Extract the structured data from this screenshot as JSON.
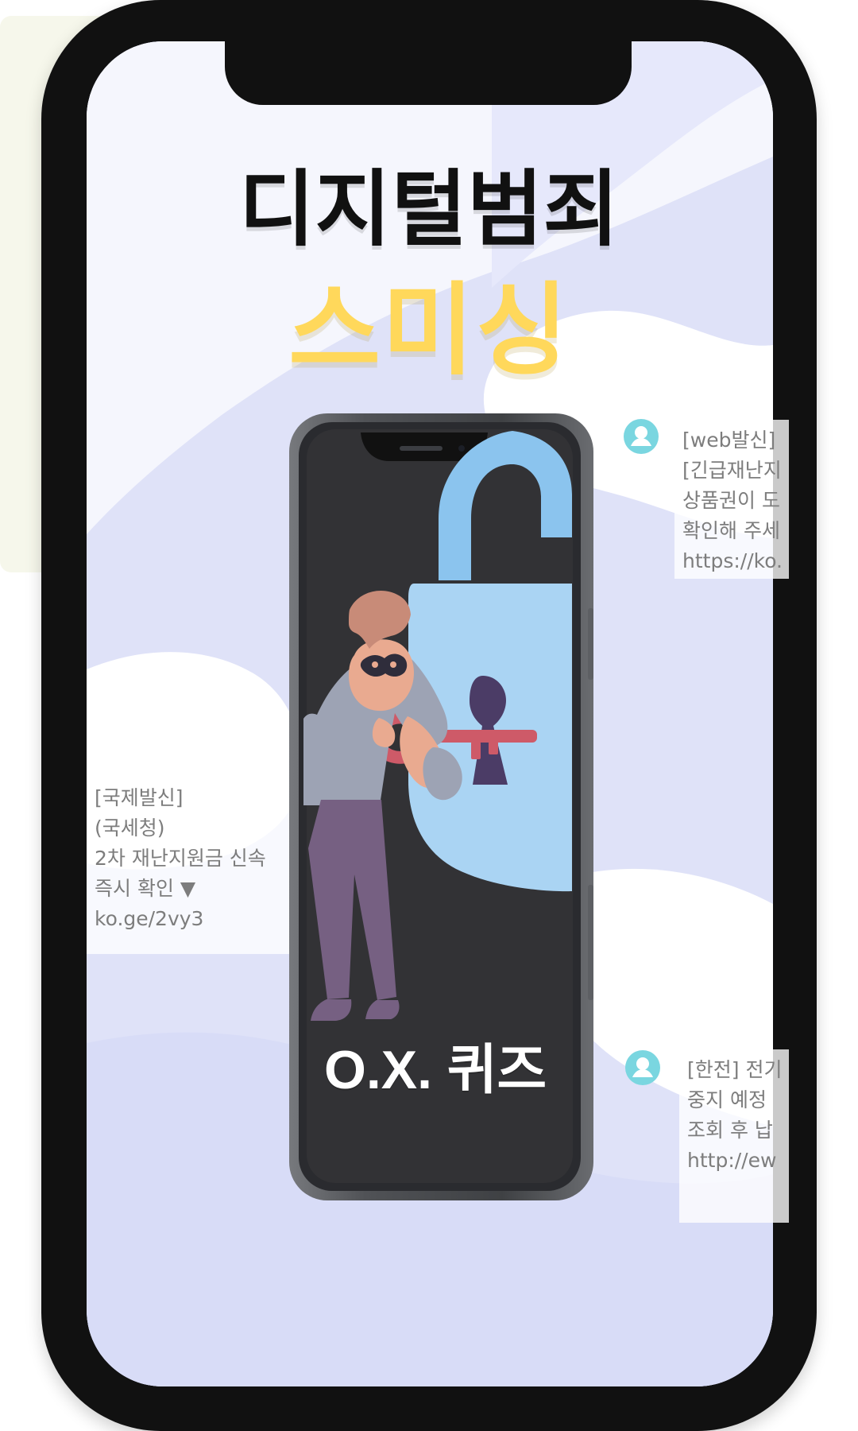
{
  "title": "디지털범죄",
  "subtitle": "스미싱",
  "quiz_label": "O.X. 퀴즈",
  "messages": [
    {
      "lines": [
        "[web발신]",
        "[긴급재난지",
        "상품권이 도",
        "확인해 주세",
        "https://ko."
      ]
    },
    {
      "lines": [
        "[국제발신]",
        "(국세청)",
        "2차 재난지원금 신속",
        "즉시 확인 ▼",
        "ko.ge/2vy3"
      ]
    },
    {
      "lines": [
        "[한전] 전기",
        "중지 예정",
        "조회 후 납",
        "http://ew"
      ]
    }
  ],
  "icons": {
    "avatar": "person-avatar-icon",
    "lock": "padlock-icon",
    "key": "key-icon",
    "character": "masked-thief-icon"
  },
  "colors": {
    "background": "#dfe2f8",
    "frame": "#111111",
    "headline": "#111111",
    "subtitle": "#ffd85b",
    "quiz_text": "#ffffff",
    "lock": "#aad4f3",
    "key": "#d05a68",
    "thief_jacket": "#9aa0b2",
    "thief_pants": "#766082",
    "avatar": "#7ad6e0"
  }
}
